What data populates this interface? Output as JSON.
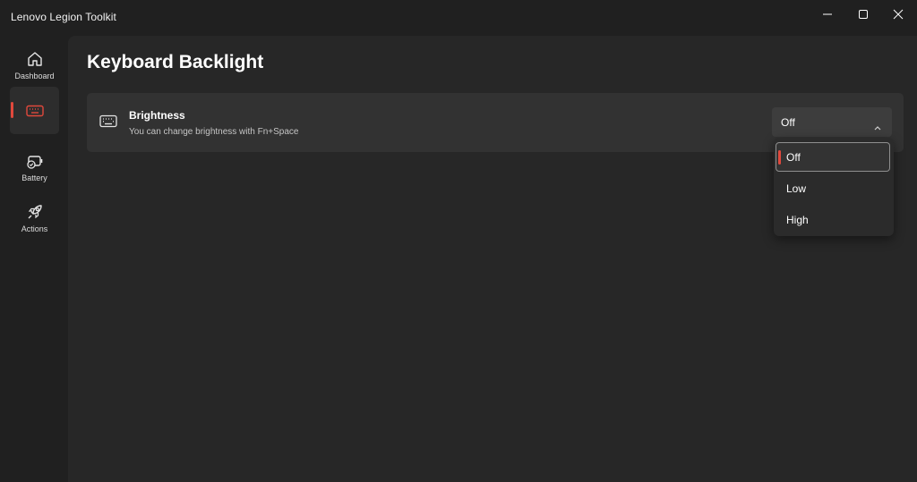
{
  "window": {
    "title": "Lenovo Legion Toolkit",
    "accent_color": "#e0483c"
  },
  "sidebar": {
    "items": [
      {
        "label": "Dashboard",
        "icon": "home-icon"
      },
      {
        "label": "",
        "icon": "keyboard-icon",
        "active": true
      },
      {
        "label": "Battery",
        "icon": "battery-icon"
      },
      {
        "label": "Actions",
        "icon": "rocket-icon"
      }
    ]
  },
  "page": {
    "title": "Keyboard Backlight"
  },
  "brightness_card": {
    "icon": "keyboard-icon",
    "title": "Brightness",
    "description": "You can change brightness with Fn+Space",
    "selected_value": "Off",
    "options": [
      "Off",
      "Low",
      "High"
    ]
  }
}
